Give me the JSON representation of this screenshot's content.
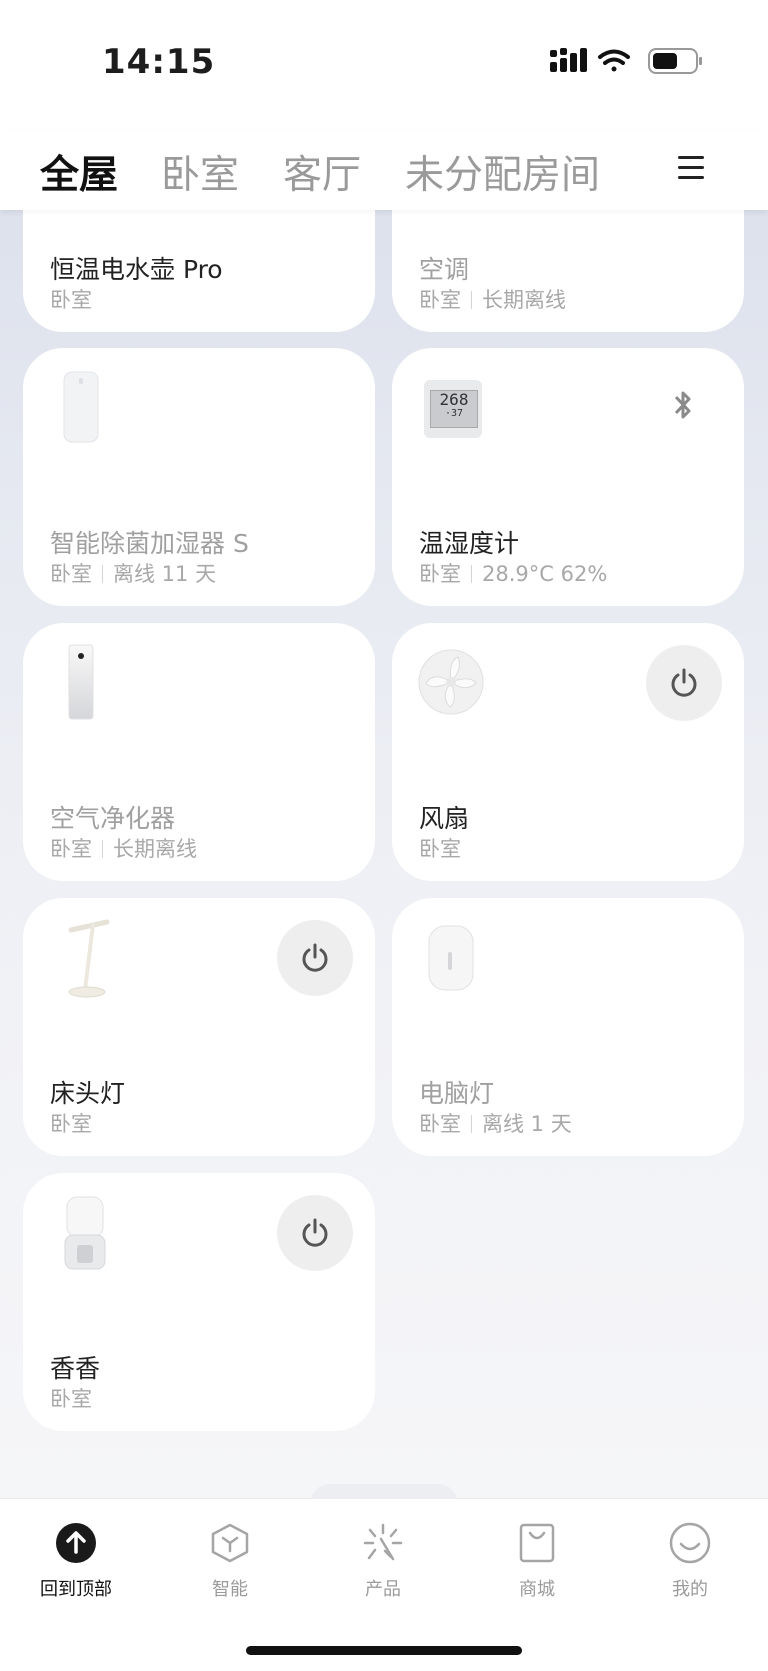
{
  "status_bar": {
    "time": "14:15"
  },
  "room_tabs": [
    {
      "label": "全屋",
      "active": true
    },
    {
      "label": "卧室",
      "active": false
    },
    {
      "label": "客厅",
      "active": false
    },
    {
      "label": "未分配房间",
      "active": false
    }
  ],
  "devices": [
    {
      "name": "恒温电水壶 Pro",
      "room": "卧室",
      "status": "",
      "offline": false
    },
    {
      "name": "空调",
      "room": "卧室",
      "status": "长期离线",
      "offline": true
    },
    {
      "name": "智能除菌加湿器  S",
      "room": "卧室",
      "status": "离线 11 天",
      "offline": true
    },
    {
      "name": "温湿度计",
      "room": "卧室",
      "status": "28.9°C 62%",
      "offline": false,
      "thermo_display": "268",
      "thermo_display_2": "·37"
    },
    {
      "name": "空气净化器",
      "room": "卧室",
      "status": "长期离线",
      "offline": true
    },
    {
      "name": "风扇",
      "room": "卧室",
      "status": "",
      "offline": false
    },
    {
      "name": "床头灯",
      "room": "卧室",
      "status": "",
      "offline": false
    },
    {
      "name": "电脑灯",
      "room": "卧室",
      "status": "离线 1 天",
      "offline": true
    },
    {
      "name": "香香",
      "room": "卧室",
      "status": "",
      "offline": false
    }
  ],
  "bottom_nav": [
    {
      "label": "回到顶部",
      "icon": "arrow-up-icon",
      "active": true
    },
    {
      "label": "智能",
      "icon": "cube-icon",
      "active": false
    },
    {
      "label": "产品",
      "icon": "sparkle-icon",
      "active": false
    },
    {
      "label": "商城",
      "icon": "shopping-bag-icon",
      "active": false
    },
    {
      "label": "我的",
      "icon": "smiley-icon",
      "active": false
    }
  ],
  "colors": {
    "accent": "#111111",
    "muted": "#9b9b9b",
    "card": "#ffffff"
  }
}
